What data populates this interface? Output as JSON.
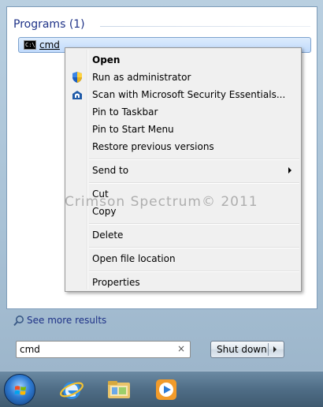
{
  "results": {
    "group_header": "Programs (1)",
    "item_label": "cmd",
    "item_icon": "cmd-console-icon"
  },
  "context_menu": {
    "items": [
      {
        "label": "Open",
        "bold": true
      },
      {
        "label": "Run as administrator",
        "icon": "uac-shield-icon"
      },
      {
        "label": "Scan with Microsoft Security Essentials...",
        "icon": "security-essentials-icon"
      },
      {
        "label": "Pin to Taskbar"
      },
      {
        "label": "Pin to Start Menu"
      },
      {
        "label": "Restore previous versions"
      },
      {
        "label": "Send to",
        "submenu": true
      },
      {
        "label": "Cut"
      },
      {
        "label": "Copy"
      },
      {
        "label": "Delete"
      },
      {
        "label": "Open file location"
      },
      {
        "label": "Properties"
      }
    ]
  },
  "watermark": "Crimson Spectrum© 2011",
  "see_more": {
    "label": "See more results"
  },
  "search": {
    "value": "cmd",
    "clear_glyph": "×"
  },
  "shutdown": {
    "label": "Shut down"
  },
  "taskbar": {
    "items": [
      "start-orb",
      "internet-explorer-icon",
      "windows-explorer-icon",
      "media-player-icon"
    ]
  },
  "colors": {
    "link": "#1e3287",
    "highlight": "#c1dbfc",
    "taskbar": "#4f6d86"
  }
}
